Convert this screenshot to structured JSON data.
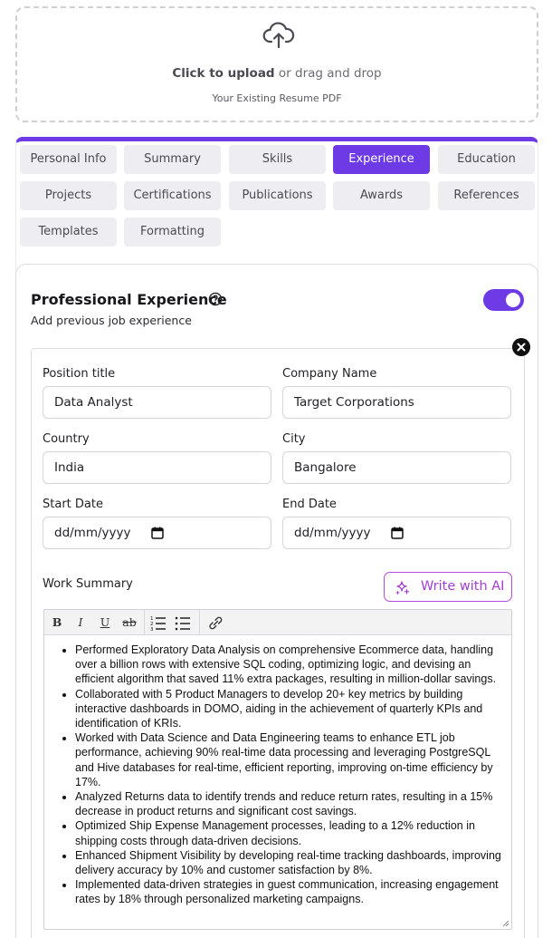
{
  "upload": {
    "click_label": "Click to upload",
    "rest_label": " or drag and drop",
    "sub_label": "Your Existing Resume PDF"
  },
  "tabs": [
    {
      "label": "Personal Info",
      "active": false
    },
    {
      "label": "Summary",
      "active": false
    },
    {
      "label": "Skills",
      "active": false
    },
    {
      "label": "Experience",
      "active": true
    },
    {
      "label": "Education",
      "active": false
    },
    {
      "label": "Projects",
      "active": false
    },
    {
      "label": "Certifications",
      "active": false
    },
    {
      "label": "Publications",
      "active": false
    },
    {
      "label": "Awards",
      "active": false
    },
    {
      "label": "References",
      "active": false
    },
    {
      "label": "Templates",
      "active": false
    },
    {
      "label": "Formatting",
      "active": false
    }
  ],
  "section": {
    "title": "Professional Experience",
    "subtitle": "Add previous job experience",
    "enabled": true
  },
  "form": {
    "position_label": "Position title",
    "position_value": "Data Analyst",
    "company_label": "Company Name",
    "company_value": "Target Corporations",
    "country_label": "Country",
    "country_value": "India",
    "city_label": "City",
    "city_value": "Bangalore",
    "start_label": "Start Date",
    "start_value": "dd/mm/yyyy",
    "end_label": "End Date",
    "end_value": "dd/mm/yyyy",
    "summary_label": "Work Summary",
    "ai_button": "Write with AI"
  },
  "toolbar": {
    "bold": "B",
    "italic": "I",
    "underline": "U",
    "strike": "ab"
  },
  "bullets": [
    "Performed Exploratory Data Analysis on comprehensive Ecommerce data, handling over a billion rows with extensive SQL coding, optimizing logic, and devising an efficient algorithm that saved 11% extra packages, resulting in million-dollar savings.",
    "Collaborated with 5 Product Managers to develop 20+ key metrics by building interactive dashboards in DOMO, aiding in the achievement of quarterly KPIs and identification of KRIs.",
    "Worked with Data Science and Data Engineering teams to enhance ETL job performance, achieving 90% real-time data processing and leveraging PostgreSQL and Hive databases for real-time, efficient reporting, improving on-time efficiency by 17%.",
    "Analyzed Returns data to identify trends and reduce return rates, resulting in a 15% decrease in product returns and significant cost savings.",
    "Optimized Ship Expense Management processes, leading to a 12% reduction in shipping costs through data-driven decisions.",
    "Enhanced Shipment Visibility by developing real-time tracking dashboards, improving delivery accuracy by 10% and customer satisfaction by 8%.",
    "Implemented data-driven strategies in guest communication, increasing engagement rates by 18% through personalized marketing campaigns."
  ],
  "colors": {
    "accent": "#6e3ae6",
    "ai": "#a23fd1"
  }
}
